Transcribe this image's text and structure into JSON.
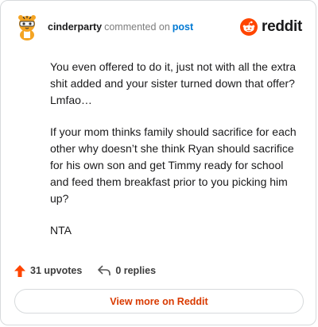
{
  "header": {
    "username": "cinderparty",
    "verb": "commented on",
    "post_link": "post",
    "brand": "reddit"
  },
  "comment": {
    "paragraphs": [
      "You even offered to do it, just not with all the extra shit added and your sister turned down that offer? Lmfao…",
      "If your mom thinks family should sacrifice for each other why doesn’t she think Ryan should sacrifice for his own son and get Timmy ready for school and feed them breakfast prior to you picking him up?",
      "NTA"
    ]
  },
  "actions": {
    "upvotes": "31 upvotes",
    "replies": "0 replies"
  },
  "footer": {
    "view_more": "View more on Reddit"
  },
  "colors": {
    "accent": "#ff4500",
    "link": "#0079d3",
    "view_more": "#d93a00"
  },
  "icons": {
    "avatar": "tiger-avatar-icon",
    "brand": "reddit-snoo-icon",
    "upvote": "upvote-arrow-icon",
    "reply": "reply-arrow-icon"
  }
}
